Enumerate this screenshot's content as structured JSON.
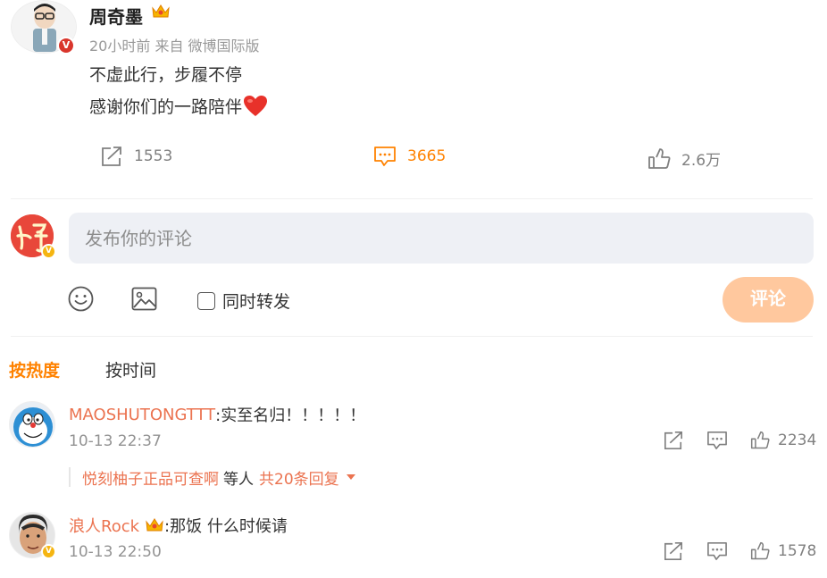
{
  "post": {
    "author": "周奇墨",
    "meta": "20小时前  来自 微博国际版",
    "lines": [
      "不虚此行，步履不停",
      "感谢你们的一路陪伴"
    ],
    "verified_badge": "V",
    "actions": {
      "repost_count": "1553",
      "comment_count": "3665",
      "like_count": "2.6万"
    }
  },
  "composer": {
    "placeholder": "发布你的评论",
    "repost_label": "同时转发",
    "submit_label": "评论"
  },
  "sort_tabs": [
    "按热度",
    "按时间"
  ],
  "comments": [
    {
      "user": "MAOSHUTONGTTT",
      "text": ":实至名归！！！！！",
      "time": "10-13 22:37",
      "likes": "2234",
      "reply": {
        "user": "悦刻柚子正品可查啊",
        "middle": "等人",
        "more": "共20条回复"
      }
    },
    {
      "user": "浪人Rock",
      "text": ":那饭 什么时候请",
      "time": "10-13 22:50",
      "likes": "1578"
    }
  ],
  "colors": {
    "accent": "#ff8200",
    "username": "#eb7350",
    "submit_bg": "#ffc89e",
    "input_bg": "#eef0f5",
    "verified_red": "#d9362c",
    "verified_gold": "#f5b511"
  }
}
